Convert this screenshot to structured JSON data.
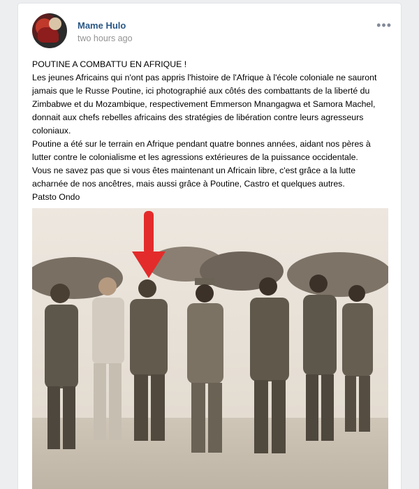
{
  "post": {
    "author": "Mame Hulo",
    "timestamp": "two hours ago",
    "more_icon": "more-icon",
    "text_lines": [
      "POUTINE A COMBATTU EN AFRIQUE !",
      "Les jeunes Africains qui n'ont pas appris l'histoire de l'Afrique à l'école coloniale ne sauront jamais que le Russe Poutine, ici photographié aux côtés des combattants de la liberté du Zimbabwe et du Mozambique, respectivement Emmerson Mnangagwa et Samora Machel, donnait aux chefs rebelles africains des stratégies de libération contre leurs agresseurs coloniaux.",
      "Poutine a été sur le terrain en Afrique pendant quatre bonnes années, aidant nos pères à lutter contre le colonialisme et les agressions extérieures de la puissance occidentale.",
      "Vous ne savez pas que si vous êtes maintenant un Africain libre, c'est grâce a la lutte acharnée de nos ancêtres, mais aussi grâce à Poutine, Castro et quelques autres.",
      "Patsto Ondo"
    ]
  },
  "colors": {
    "background": "#edeef0",
    "link": "#2a5885",
    "muted": "#939393",
    "arrow": "#e32b2b"
  }
}
